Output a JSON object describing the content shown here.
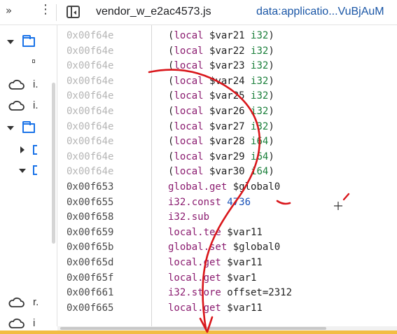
{
  "toolbar": {
    "more_panels_glyph": "»",
    "menu_glyph": "⋮",
    "panel_toggle_icon": "sidebar-toggle-icon",
    "active_tab": "vendor_w_e2ac4573.js",
    "data_tab": "data:applicatio...VuBjAuM"
  },
  "navigator": {
    "items": [
      {
        "letter": ""
      },
      {
        "letter": "i."
      },
      {
        "letter": "i."
      },
      {
        "letter": "r."
      },
      {
        "letter": "i"
      }
    ]
  },
  "code_lines": [
    {
      "addr": "0x00f64e",
      "dim": true,
      "tokens": [
        [
          "t-punc",
          "("
        ],
        [
          "t-kw",
          "local"
        ],
        [
          "t-var",
          " $var21 "
        ],
        [
          "t-type",
          "i32"
        ],
        [
          "t-punc",
          ")"
        ]
      ]
    },
    {
      "addr": "0x00f64e",
      "dim": true,
      "tokens": [
        [
          "t-punc",
          "("
        ],
        [
          "t-kw",
          "local"
        ],
        [
          "t-var",
          " $var22 "
        ],
        [
          "t-type",
          "i32"
        ],
        [
          "t-punc",
          ")"
        ]
      ]
    },
    {
      "addr": "0x00f64e",
      "dim": true,
      "tokens": [
        [
          "t-punc",
          "("
        ],
        [
          "t-kw",
          "local"
        ],
        [
          "t-var",
          " $var23 "
        ],
        [
          "t-type",
          "i32"
        ],
        [
          "t-punc",
          ")"
        ]
      ]
    },
    {
      "addr": "0x00f64e",
      "dim": true,
      "tokens": [
        [
          "t-punc",
          "("
        ],
        [
          "t-kw",
          "local"
        ],
        [
          "t-var",
          " $var24 "
        ],
        [
          "t-type",
          "i32"
        ],
        [
          "t-punc",
          ")"
        ]
      ]
    },
    {
      "addr": "0x00f64e",
      "dim": true,
      "tokens": [
        [
          "t-punc",
          "("
        ],
        [
          "t-kw",
          "local"
        ],
        [
          "t-var",
          " $var25 "
        ],
        [
          "t-type",
          "i32"
        ],
        [
          "t-punc",
          ")"
        ]
      ]
    },
    {
      "addr": "0x00f64e",
      "dim": true,
      "tokens": [
        [
          "t-punc",
          "("
        ],
        [
          "t-kw",
          "local"
        ],
        [
          "t-var",
          " $var26 "
        ],
        [
          "t-type",
          "i32"
        ],
        [
          "t-punc",
          ")"
        ]
      ]
    },
    {
      "addr": "0x00f64e",
      "dim": true,
      "tokens": [
        [
          "t-punc",
          "("
        ],
        [
          "t-kw",
          "local"
        ],
        [
          "t-var",
          " $var27 "
        ],
        [
          "t-type",
          "i32"
        ],
        [
          "t-punc",
          ")"
        ]
      ]
    },
    {
      "addr": "0x00f64e",
      "dim": true,
      "tokens": [
        [
          "t-punc",
          "("
        ],
        [
          "t-kw",
          "local"
        ],
        [
          "t-var",
          " $var28 "
        ],
        [
          "t-type",
          "i64"
        ],
        [
          "t-punc",
          ")"
        ]
      ]
    },
    {
      "addr": "0x00f64e",
      "dim": true,
      "tokens": [
        [
          "t-punc",
          "("
        ],
        [
          "t-kw",
          "local"
        ],
        [
          "t-var",
          " $var29 "
        ],
        [
          "t-type",
          "i64"
        ],
        [
          "t-punc",
          ")"
        ]
      ]
    },
    {
      "addr": "0x00f64e",
      "dim": true,
      "tokens": [
        [
          "t-punc",
          "("
        ],
        [
          "t-kw",
          "local"
        ],
        [
          "t-var",
          " $var30 "
        ],
        [
          "t-type",
          "i64"
        ],
        [
          "t-punc",
          ")"
        ]
      ]
    },
    {
      "addr": "0x00f653",
      "dim": false,
      "tokens": [
        [
          "t-kw",
          "global.get"
        ],
        [
          "t-var",
          " $global0"
        ]
      ]
    },
    {
      "addr": "0x00f655",
      "dim": false,
      "tokens": [
        [
          "t-kw",
          "i32.const"
        ],
        [
          "t-var",
          " "
        ],
        [
          "t-num",
          "4736"
        ]
      ]
    },
    {
      "addr": "0x00f658",
      "dim": false,
      "tokens": [
        [
          "t-kw",
          "i32.sub"
        ]
      ]
    },
    {
      "addr": "0x00f659",
      "dim": false,
      "tokens": [
        [
          "t-kw",
          "local.tee"
        ],
        [
          "t-var",
          " $var11"
        ]
      ]
    },
    {
      "addr": "0x00f65b",
      "dim": false,
      "tokens": [
        [
          "t-kw",
          "global.set"
        ],
        [
          "t-var",
          " $global0"
        ]
      ]
    },
    {
      "addr": "0x00f65d",
      "dim": false,
      "tokens": [
        [
          "t-kw",
          "local.get"
        ],
        [
          "t-var",
          " $var11"
        ]
      ]
    },
    {
      "addr": "0x00f65f",
      "dim": false,
      "tokens": [
        [
          "t-kw",
          "local.get"
        ],
        [
          "t-var",
          " $var1"
        ]
      ]
    },
    {
      "addr": "0x00f661",
      "dim": false,
      "tokens": [
        [
          "t-kw",
          "i32.store"
        ],
        [
          "t-var",
          " offset=2312"
        ]
      ]
    },
    {
      "addr": "0x00f665",
      "dim": false,
      "tokens": [
        [
          "t-kw",
          "local.get"
        ],
        [
          "t-var",
          " $var11"
        ]
      ]
    }
  ],
  "colors": {
    "keyword": "#8b1c70",
    "type": "#1a7f3a",
    "number": "#1a52b8",
    "address_dim": "#b5b5b5",
    "annotation": "#d9161b",
    "status_bar": "#f2bd42"
  }
}
